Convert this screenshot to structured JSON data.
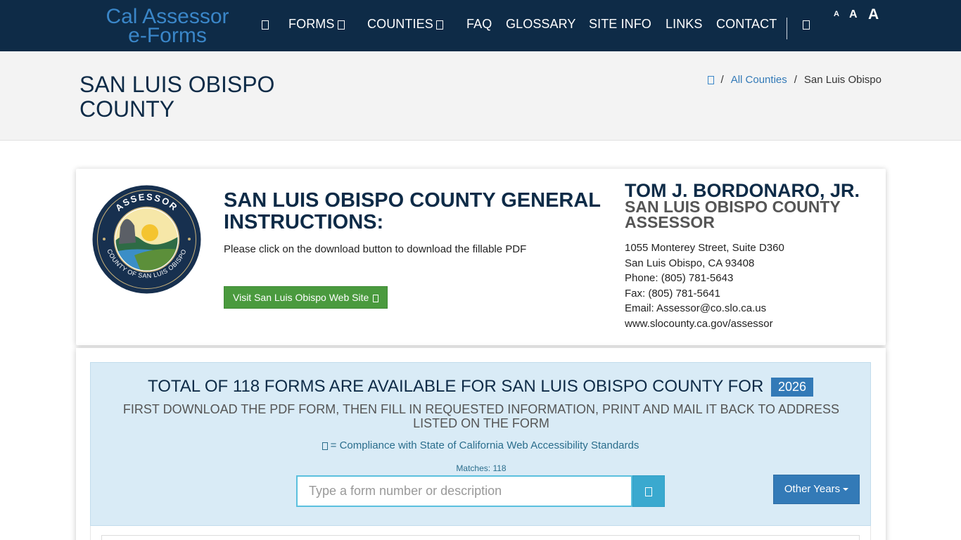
{
  "logo": {
    "line1": "Cal Assessor",
    "line2": "e-Forms"
  },
  "nav": {
    "forms": "FORMS",
    "counties": "COUNTIES",
    "faq": "FAQ",
    "glossary": "GLOSSARY",
    "site_info": "SITE INFO",
    "links": "LINKS",
    "contact": "CONTACT"
  },
  "font_sizes": {
    "small": "A",
    "medium": "A",
    "large": "A"
  },
  "header": {
    "title": "SAN LUIS OBISPO COUNTY",
    "breadcrumb": {
      "all_counties": "All Counties",
      "current": "San Luis Obispo",
      "separator": "/"
    }
  },
  "county": {
    "instructions_title": "SAN LUIS OBISPO COUNTY GENERAL INSTRUCTIONS:",
    "instructions_text": "Please click on the download button to download the fillable PDF",
    "visit_button": "Visit San Luis Obispo Web Site",
    "seal_top_text": "ASSESSOR",
    "seal_bottom_text": "COUNTY OF SAN LUIS OBISPO"
  },
  "assessor": {
    "name": "TOM J. BORDONARO, JR.",
    "title": "SAN LUIS OBISPO COUNTY ASSESSOR",
    "address1": "1055 Monterey Street, Suite D360",
    "address2": "San Luis Obispo, CA 93408",
    "phone": "Phone: (805) 781-5643",
    "fax": "Fax: (805) 781-5641",
    "email": "Email: Assessor@co.slo.ca.us",
    "website": "www.slocounty.ca.gov/assessor"
  },
  "forms": {
    "heading": "TOTAL OF 118 FORMS ARE AVAILABLE FOR SAN LUIS OBISPO COUNTY FOR",
    "year": "2026",
    "subheading": "FIRST DOWNLOAD THE PDF FORM, THEN FILL IN REQUESTED INFORMATION, PRINT AND MAIL IT BACK TO ADDRESS LISTED ON THE FORM",
    "compliance": "= Compliance with State of California Web Accessibility Standards",
    "matches": "Matches: 118",
    "search_placeholder": "Type a form number or description",
    "other_years": "Other Years"
  },
  "colors": {
    "navbar": "#0e2b47",
    "accent": "#337ab7",
    "green_button": "#4a9a3e",
    "panel": "#d9ebf6"
  }
}
